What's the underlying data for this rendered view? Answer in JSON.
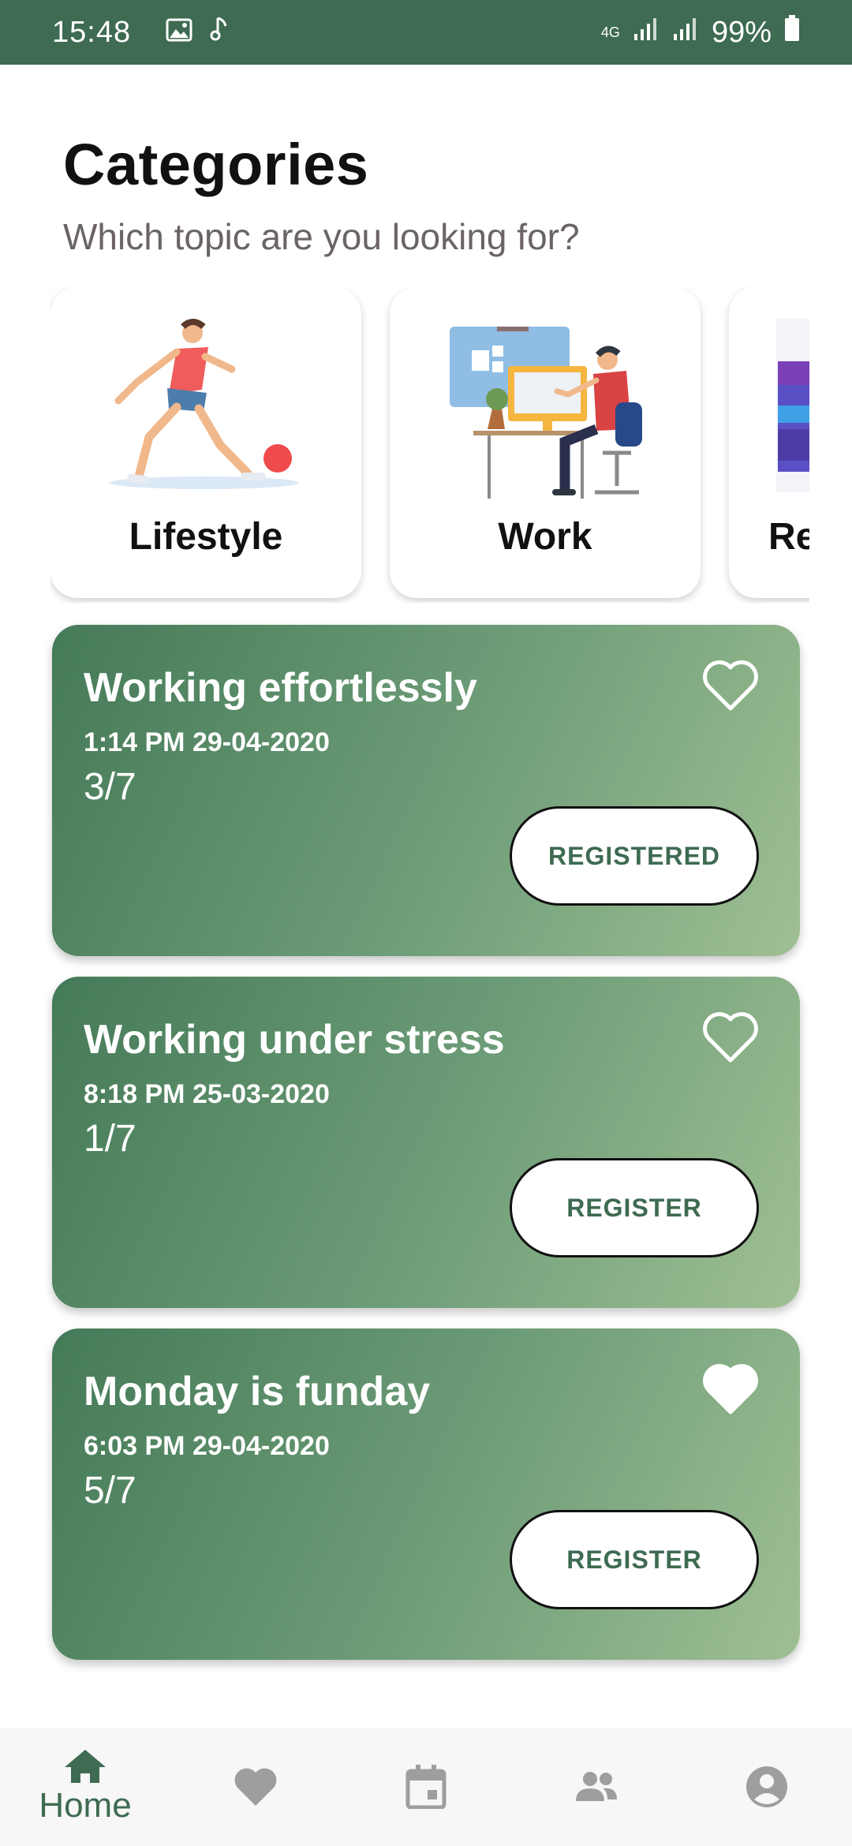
{
  "status_bar": {
    "time": "15:48",
    "network": "4G",
    "battery": "99%"
  },
  "header": {
    "title": "Categories",
    "subtitle": "Which topic are you looking for?"
  },
  "categories": [
    {
      "label": "Lifestyle"
    },
    {
      "label": "Work"
    },
    {
      "label": "Re"
    }
  ],
  "events": [
    {
      "title": "Working effortlessly",
      "datetime": "1:14 PM 29-04-2020",
      "count": "3/7",
      "button": "REGISTERED",
      "favorited": false
    },
    {
      "title": "Working under stress",
      "datetime": "8:18 PM 25-03-2020",
      "count": "1/7",
      "button": "REGISTER",
      "favorited": false
    },
    {
      "title": "Monday is funday",
      "datetime": "6:03 PM 29-04-2020",
      "count": "5/7",
      "button": "REGISTER",
      "favorited": true
    }
  ],
  "bottom_nav": {
    "home_label": "Home",
    "items": [
      {
        "icon": "home-icon",
        "active": true
      },
      {
        "icon": "heart-icon",
        "active": false
      },
      {
        "icon": "calendar-icon",
        "active": false
      },
      {
        "icon": "people-icon",
        "active": false
      },
      {
        "icon": "account-icon",
        "active": false
      }
    ]
  },
  "colors": {
    "brand": "#3e6b52",
    "card_gradient_start": "#457a58",
    "card_gradient_end": "#9fbf93",
    "nav_inactive": "#9e9e9e"
  }
}
